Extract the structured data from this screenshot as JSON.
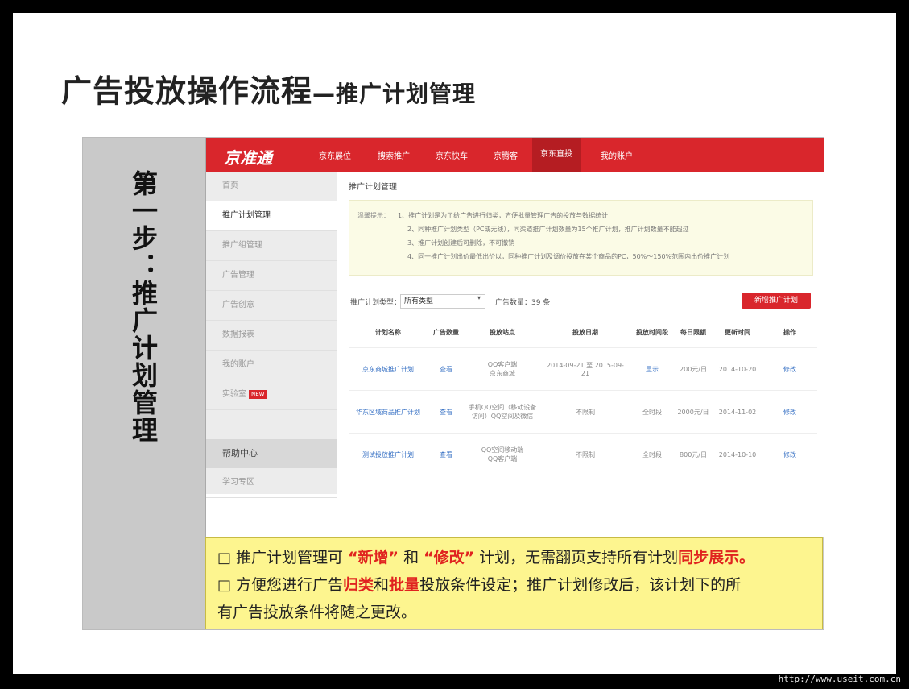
{
  "slide": {
    "title": "广告投放操作流程",
    "subtitle": "—推广计划管理",
    "step_label": "第一步：推广计划管理"
  },
  "app": {
    "logo": "京准通",
    "nav": [
      "京东展位",
      "搜索推广",
      "京东快车",
      "京腾客",
      "京东直投",
      "我的账户"
    ]
  },
  "sidebar": {
    "items": [
      "首页",
      "推广计划管理",
      "推广组管理",
      "广告管理",
      "广告创意",
      "数据报表",
      "我的账户",
      "实验室"
    ],
    "new_tag": "NEW",
    "help_title": "帮助中心",
    "help_items": [
      "学习专区"
    ]
  },
  "main": {
    "breadcrumb": "推广计划管理",
    "notice_label": "温馨提示：",
    "notice_lines": [
      "1、推广计划是为了给广告进行归类，方便批量管理广告的投放与数据统计",
      "2、同种推广计划类型（PC或无线），同渠道推广计划数量为15个推广计划，推广计划数量不能超过",
      "3、推广计划创建后可删除，不可撤销",
      "4、同一推广计划出价最低出价以，同种推广计划及调价投放在某个商品的PC，50%～150%范围内出价推广计划"
    ],
    "filter_label": "推广计划类型：",
    "filter_value": "所有类型",
    "count_text": "广告数量：39 条",
    "new_button": "新增推广计划",
    "columns": [
      "计划名称",
      "广告数量",
      "投放站点",
      "投放日期",
      "投放时间段",
      "每日限额",
      "更新时间",
      "操作"
    ],
    "rows": [
      [
        "京东商城推广计划",
        "查看",
        "QQ客户端\n京东商城",
        "2014-09-21 至 2015-09-21",
        "显示",
        "200元/日",
        "2014-10-20",
        "修改"
      ],
      [
        "华东区域商品推广计划",
        "查看",
        "手机QQ空间（移动设备访问）QQ空间及微信",
        "不限制",
        "全时段",
        "2000元/日",
        "2014-11-02",
        "修改"
      ],
      [
        "测试投放推广计划",
        "查看",
        "QQ空间移动端\nQQ客户端",
        "不限制",
        "全时段",
        "800元/日",
        "2014-10-10",
        "修改"
      ]
    ]
  },
  "caption": {
    "line1": {
      "a": "推广计划管理可 ",
      "h1": "“新增”",
      "b": " 和 ",
      "h2": "“修改”",
      "c": " 计划，无需翻页支持所有计划",
      "h3": "同步展示。"
    },
    "line2": {
      "a": "方便您进行广告",
      "h1": "归类",
      "b": "和",
      "h2": "批量",
      "c": "投放条件设定；推广计划修改后，该计划下的所"
    },
    "line3": "有广告投放条件将随之更改。"
  },
  "watermark": "http://www.useit.com.cn"
}
